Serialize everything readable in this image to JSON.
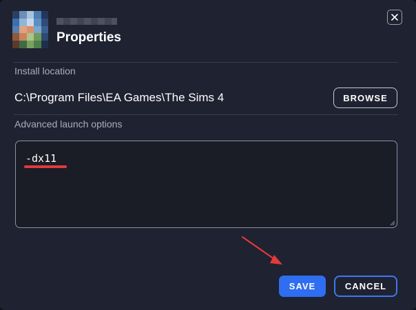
{
  "dialog": {
    "title": "Properties",
    "close_icon": "close-icon"
  },
  "install": {
    "label": "Install location",
    "path": "C:\\Program Files\\EA Games\\The Sims 4",
    "browse_label": "BROWSE"
  },
  "launch": {
    "label": "Advanced launch options",
    "value": "-dx11"
  },
  "actions": {
    "save_label": "SAVE",
    "cancel_label": "CANCEL"
  },
  "colors": {
    "background": "#1f2230",
    "accent": "#2f6ef0",
    "annotation": "#e23a3a"
  }
}
